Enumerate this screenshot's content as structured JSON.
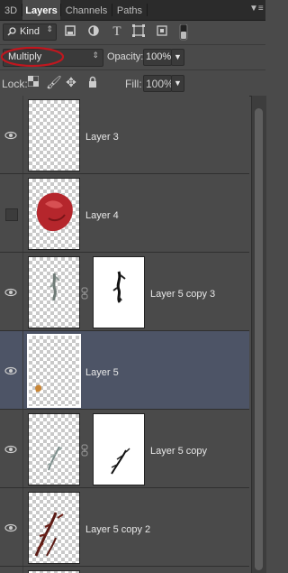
{
  "tabs": [
    {
      "label": "3D",
      "active": false
    },
    {
      "label": "Layers",
      "active": true
    },
    {
      "label": "Channels",
      "active": false
    },
    {
      "label": "Paths",
      "active": false
    }
  ],
  "panel_menu_icon": "panel-menu-icon",
  "filter": {
    "kind_label": "Kind",
    "icons": [
      "pixel-filter-icon",
      "adjustment-filter-icon",
      "type-filter-icon",
      "shape-filter-icon",
      "smart-object-filter-icon",
      "filter-toggle-icon"
    ]
  },
  "blend": {
    "mode": "Multiply",
    "opacity_label": "Opacity:",
    "opacity_value": "100%"
  },
  "lock": {
    "label": "Lock:",
    "icons": [
      "lock-transparent-icon",
      "lock-image-icon",
      "lock-position-icon",
      "lock-all-icon"
    ],
    "fill_label": "Fill:",
    "fill_value": "100%"
  },
  "layers": [
    {
      "name": "Layer 3",
      "visible": true,
      "selected": false,
      "has_mask": false,
      "content": "empty"
    },
    {
      "name": "Layer 4",
      "visible": false,
      "selected": false,
      "has_mask": false,
      "content": "red-object"
    },
    {
      "name": "Layer 5 copy 3",
      "visible": true,
      "selected": false,
      "has_mask": true,
      "content": "gray-strokes"
    },
    {
      "name": "Layer 5",
      "visible": true,
      "selected": true,
      "has_mask": false,
      "content": "orange-blob"
    },
    {
      "name": "Layer 5 copy",
      "visible": true,
      "selected": false,
      "has_mask": true,
      "content": "gray-strokes"
    },
    {
      "name": "Layer 5 copy 2",
      "visible": true,
      "selected": false,
      "has_mask": false,
      "content": "dark-red-strokes"
    }
  ],
  "colors": {
    "panel_bg": "#4a4a4a",
    "selected_row": "#4d5466",
    "blend_highlight": "#c0171f"
  }
}
